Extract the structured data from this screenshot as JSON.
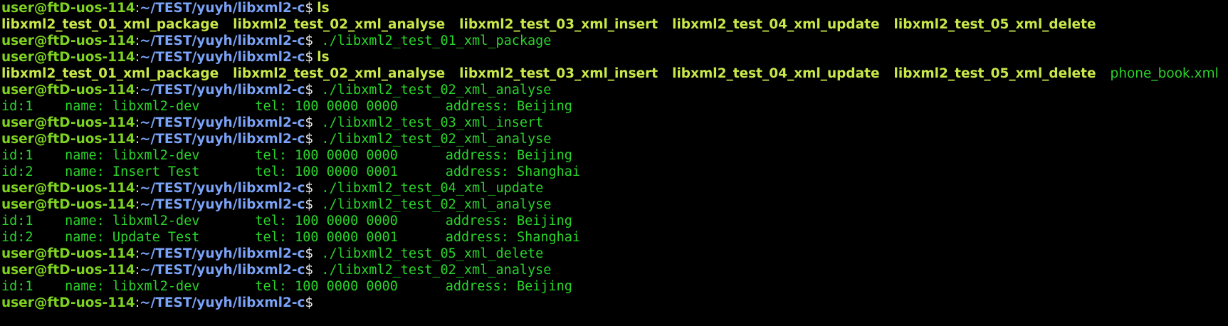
{
  "prompt": {
    "user_host": "user@ftD-uos-114",
    "sep": ":",
    "path": "~/TEST/yuyh/libxml2-c",
    "dollar": "$"
  },
  "lines": [
    {
      "kind": "prompt",
      "cmd": "ls",
      "cmd_style": "plain"
    },
    {
      "kind": "ls",
      "entries": [
        {
          "name": "libxml2_test_01_xml_package",
          "type": "exe"
        },
        {
          "name": "libxml2_test_02_xml_analyse",
          "type": "exe"
        },
        {
          "name": "libxml2_test_03_xml_insert",
          "type": "exe"
        },
        {
          "name": "libxml2_test_04_xml_update",
          "type": "exe"
        },
        {
          "name": "libxml2_test_05_xml_delete",
          "type": "exe"
        }
      ]
    },
    {
      "kind": "prompt",
      "cmd": " ./libxml2_test_01_xml_package",
      "cmd_style": "mono"
    },
    {
      "kind": "prompt",
      "cmd": "ls",
      "cmd_style": "plain"
    },
    {
      "kind": "ls",
      "entries": [
        {
          "name": "libxml2_test_01_xml_package",
          "type": "exe"
        },
        {
          "name": "libxml2_test_02_xml_analyse",
          "type": "exe"
        },
        {
          "name": "libxml2_test_03_xml_insert",
          "type": "exe"
        },
        {
          "name": "libxml2_test_04_xml_update",
          "type": "exe"
        },
        {
          "name": "libxml2_test_05_xml_delete",
          "type": "exe"
        },
        {
          "name": "phone_book.xml",
          "type": "file"
        }
      ]
    },
    {
      "kind": "prompt",
      "cmd": " ./libxml2_test_02_xml_analyse",
      "cmd_style": "mono"
    },
    {
      "kind": "output",
      "text": "id:1    name: libxml2-dev       tel: 100 0000 0000      address: Beijing"
    },
    {
      "kind": "prompt",
      "cmd": " ./libxml2_test_03_xml_insert",
      "cmd_style": "mono"
    },
    {
      "kind": "prompt",
      "cmd": " ./libxml2_test_02_xml_analyse",
      "cmd_style": "mono"
    },
    {
      "kind": "output",
      "text": "id:1    name: libxml2-dev       tel: 100 0000 0000      address: Beijing"
    },
    {
      "kind": "output",
      "text": "id:2    name: Insert Test       tel: 100 0000 0001      address: Shanghai"
    },
    {
      "kind": "prompt",
      "cmd": " ./libxml2_test_04_xml_update",
      "cmd_style": "mono"
    },
    {
      "kind": "prompt",
      "cmd": " ./libxml2_test_02_xml_analyse",
      "cmd_style": "mono"
    },
    {
      "kind": "output",
      "text": "id:1    name: libxml2-dev       tel: 100 0000 0000      address: Beijing"
    },
    {
      "kind": "output",
      "text": "id:2    name: Update Test       tel: 100 0000 0001      address: Shanghai"
    },
    {
      "kind": "prompt",
      "cmd": " ./libxml2_test_05_xml_delete",
      "cmd_style": "mono"
    },
    {
      "kind": "prompt",
      "cmd": " ./libxml2_test_02_xml_analyse",
      "cmd_style": "mono"
    },
    {
      "kind": "output",
      "text": "id:1    name: libxml2-dev       tel: 100 0000 0000      address: Beijing"
    },
    {
      "kind": "prompt",
      "cmd": "",
      "cmd_style": "mono",
      "active": true
    }
  ]
}
